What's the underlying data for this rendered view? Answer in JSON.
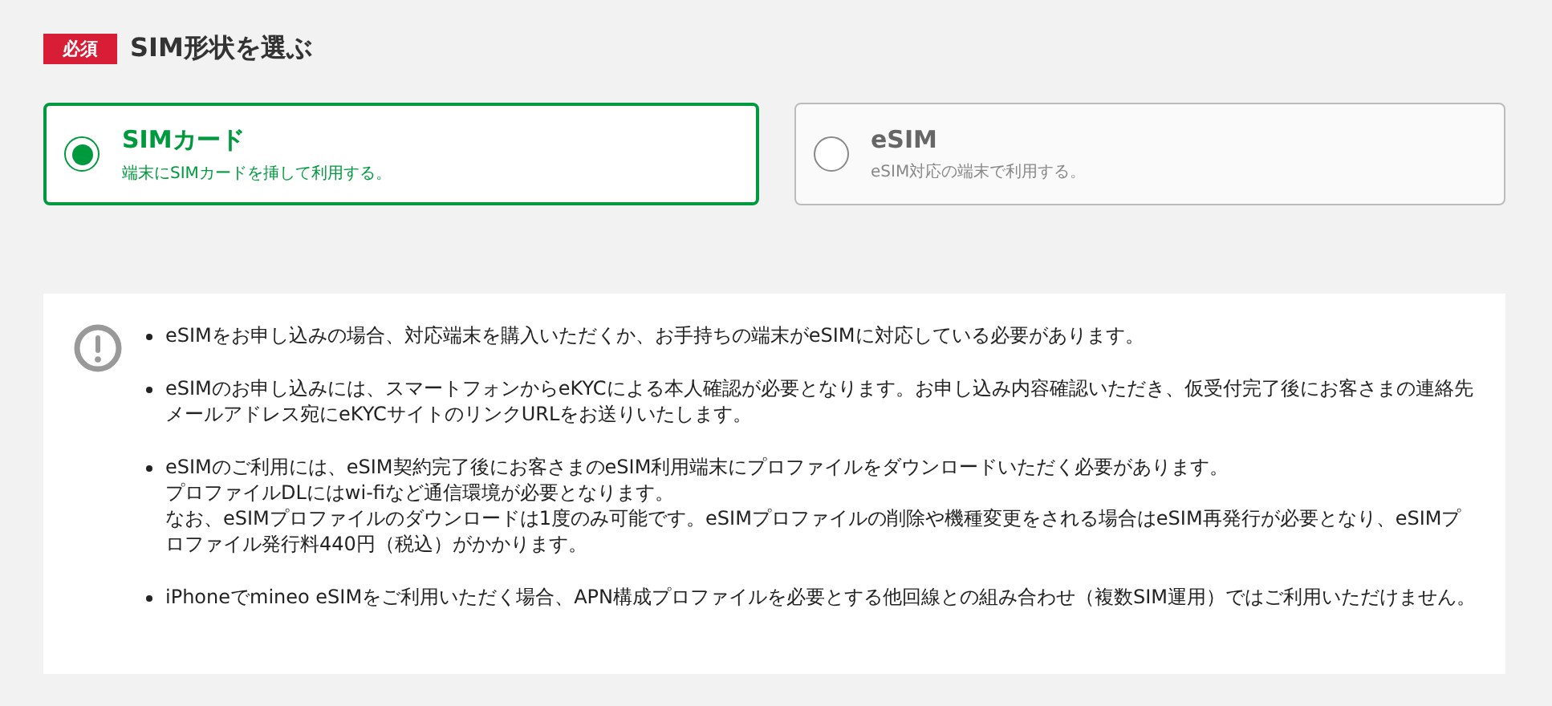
{
  "section": {
    "badge": "必須",
    "title": "SIM形状を選ぶ"
  },
  "options": [
    {
      "label": "SIMカード",
      "description": "端末にSIMカードを挿して利用する。",
      "selected": true
    },
    {
      "label": "eSIM",
      "description": "eSIM対応の端末で利用する。",
      "selected": false
    }
  ],
  "notes": [
    {
      "paragraphs": [
        "eSIMをお申し込みの場合、対応端末を購入いただくか、お手持ちの端末がeSIMに対応している必要があります。"
      ]
    },
    {
      "paragraphs": [
        "eSIMのお申し込みには、スマートフォンからeKYCによる本人確認が必要となります。お申し込み内容確認いただき、仮受付完了後にお客さまの連絡先メールアドレス宛にeKYCサイトのリンクURLをお送りいたします。"
      ]
    },
    {
      "paragraphs": [
        "eSIMのご利用には、eSIM契約完了後にお客さまのeSIM利用端末にプロファイルをダウンロードいただく必要があります。",
        "プロファイルDLにはwi-fiなど通信環境が必要となります。",
        "なお、eSIMプロファイルのダウンロードは1度のみ可能です。eSIMプロファイルの削除や機種変更をされる場合はeSIM再発行が必要となり、eSIMプロファイル発行料440円（税込）がかかります。"
      ]
    },
    {
      "paragraphs": [
        "iPhoneでmineo eSIMをご利用いただく場合、APN構成プロファイルを必要とする他回線との組み合わせ（複数SIM運用）ではご利用いただけません。"
      ]
    }
  ]
}
